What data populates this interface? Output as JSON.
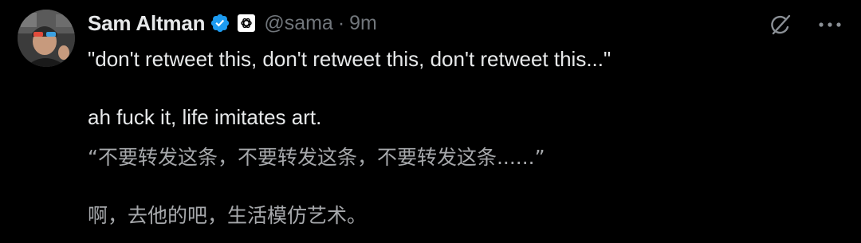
{
  "author": {
    "display_name": "Sam Altman",
    "handle": "@sama",
    "separator": "·",
    "time": "9m"
  },
  "icons": {
    "avatar": "avatar-photo",
    "verified": "verified-badge-icon",
    "affiliate": "openai-logo-icon",
    "grok": "grok-icon",
    "more": "more-dots-icon"
  },
  "colors": {
    "background": "#000000",
    "text": "#e7e9ea",
    "secondary_text": "#71767b",
    "verified_blue": "#1d9bf0"
  },
  "tweet": {
    "line_1": "\"don't retweet this, don't retweet this, don't retweet this...\"",
    "line_2": "ah fuck it, life imitates art.",
    "translation_1": "“不要转发这条，不要转发这条，不要转发这条......”",
    "translation_2": "啊，去他的吧，生活模仿艺术。"
  }
}
